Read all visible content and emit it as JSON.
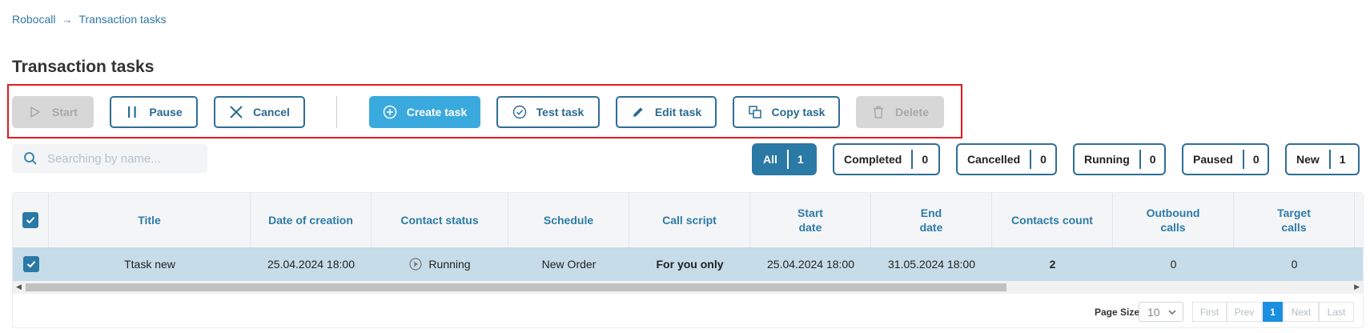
{
  "breadcrumb": {
    "root": "Robocall",
    "current": "Transaction tasks"
  },
  "page": {
    "title": "Transaction tasks"
  },
  "toolbar": {
    "start": "Start",
    "pause": "Pause",
    "cancel": "Cancel",
    "create": "Create task",
    "test": "Test task",
    "edit": "Edit task",
    "copy": "Copy task",
    "delete": "Delete"
  },
  "search": {
    "placeholder": "Searching by name..."
  },
  "filters": [
    {
      "label": "All",
      "count": "1"
    },
    {
      "label": "Completed",
      "count": "0"
    },
    {
      "label": "Cancelled",
      "count": "0"
    },
    {
      "label": "Running",
      "count": "0"
    },
    {
      "label": "Paused",
      "count": "0"
    },
    {
      "label": "New",
      "count": "1"
    }
  ],
  "table": {
    "columns": [
      "Title",
      "Date of creation",
      "Contact status",
      "Schedule",
      "Call script",
      "Start\ndate",
      "End\ndate",
      "Contacts count",
      "Outbound\ncalls",
      "Target\ncalls"
    ],
    "row": {
      "title": "Ttask new",
      "created": "25.04.2024 18:00",
      "status": "Running",
      "schedule": "New Order",
      "script": "For you only",
      "start": "25.04.2024 18:00",
      "end": "31.05.2024 18:00",
      "contacts": "2",
      "outbound": "0",
      "target": "0"
    }
  },
  "pagination": {
    "page_size_label": "Page Size",
    "page_size": "10",
    "first": "First",
    "prev": "Prev",
    "current": "1",
    "next": "Next",
    "last": "Last"
  },
  "colors": {
    "accent": "#2b79a5",
    "primary_button": "#3aa9dd",
    "highlight_frame": "#e0191f",
    "selected_row": "#c6dce8"
  }
}
